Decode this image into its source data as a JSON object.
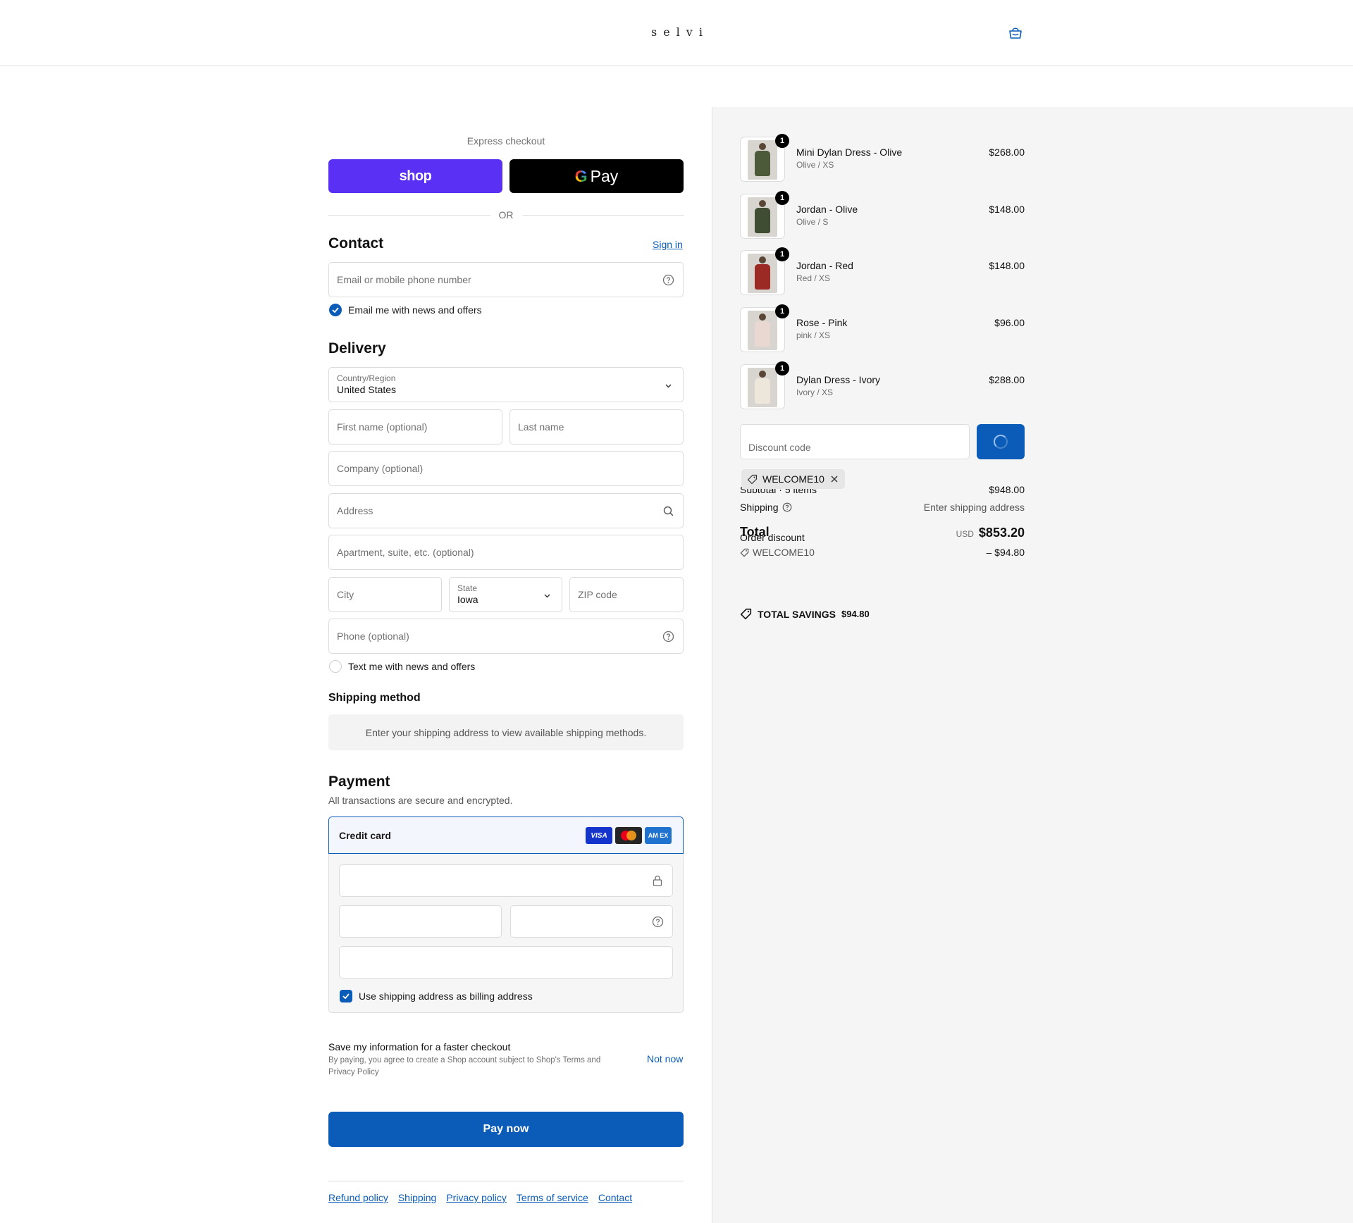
{
  "header": {
    "logo": "selvi"
  },
  "express": {
    "label": "Express checkout",
    "shop_label": "shop",
    "gpay_g": "G",
    "gpay_label": "Pay",
    "or": "OR"
  },
  "contact": {
    "title": "Contact",
    "sign_in": "Sign in",
    "email_placeholder": "Email or mobile phone number",
    "news_label": "Email me with news and offers",
    "news_checked": true
  },
  "delivery": {
    "title": "Delivery",
    "country_label": "Country/Region",
    "country_value": "United States",
    "first_name_placeholder": "First name (optional)",
    "last_name_placeholder": "Last name",
    "company_placeholder": "Company (optional)",
    "address_placeholder": "Address",
    "apartment_placeholder": "Apartment, suite, etc. (optional)",
    "city_placeholder": "City",
    "state_label": "State",
    "state_value": "Iowa",
    "zip_placeholder": "ZIP code",
    "phone_placeholder": "Phone (optional)",
    "text_label": "Text me with news and offers"
  },
  "shipping_method": {
    "title": "Shipping method",
    "message": "Enter your shipping address to view available shipping methods."
  },
  "payment": {
    "title": "Payment",
    "subtitle": "All transactions are secure and encrypted.",
    "method": "Credit card",
    "cards": [
      "VISA",
      "",
      "AM EX"
    ],
    "billing_label": "Use shipping address as billing address"
  },
  "save_info": {
    "title": "Save my information for a faster checkout",
    "note_before": "By paying, you agree to create a Shop account subject to Shop's ",
    "terms": "Terms",
    "and": " and ",
    "privacy": "Privacy Policy",
    "not_now": "Not now"
  },
  "pay_button": "Pay now",
  "footer": {
    "links": [
      "Refund policy",
      "Shipping",
      "Privacy policy",
      "Terms of service",
      "Contact"
    ]
  },
  "order": {
    "items": [
      {
        "name": "Mini Dylan Dress - Olive",
        "variant": "Olive / XS",
        "price": "$268.00",
        "qty": "1",
        "color": "#4d5a3a"
      },
      {
        "name": "Jordan - Olive",
        "variant": "Olive / S",
        "price": "$148.00",
        "qty": "1",
        "color": "#3f4d33"
      },
      {
        "name": "Jordan - Red",
        "variant": "Red / XS",
        "price": "$148.00",
        "qty": "1",
        "color": "#9b2a24"
      },
      {
        "name": "Rose - Pink",
        "variant": "pink / XS",
        "price": "$96.00",
        "qty": "1",
        "color": "#e9d8d2"
      },
      {
        "name": "Dylan Dress - Ivory",
        "variant": "Ivory / XS",
        "price": "$288.00",
        "qty": "1",
        "color": "#ece6db"
      }
    ],
    "discount_placeholder": "Discount code",
    "applied_code": "WELCOME10",
    "subtotal_label": "Subtotal · 5 items",
    "subtotal_value": "$948.00",
    "shipping_label": "Shipping",
    "shipping_value": "Enter shipping address",
    "total_label": "Total",
    "currency": "USD",
    "total_value": "$853.20",
    "order_discount_label": "Order discount",
    "discount_code": "WELCOME10",
    "discount_value": "– $94.80",
    "savings_label": "TOTAL SAVINGS",
    "savings_value": "$94.80"
  },
  "colors": {
    "accent": "#0a5cb8",
    "shop": "#5a31f4"
  }
}
